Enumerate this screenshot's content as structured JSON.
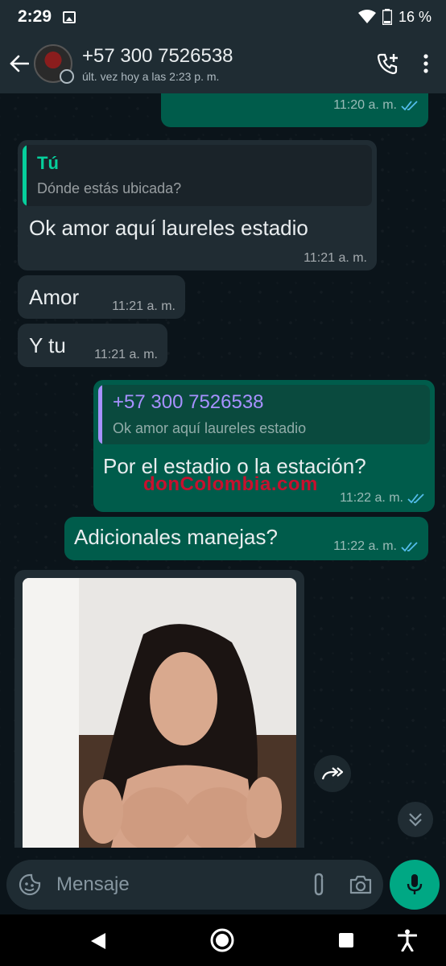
{
  "status": {
    "time": "2:29",
    "battery": "16 %"
  },
  "header": {
    "name": "+57 300 7526538",
    "last_seen": "últ. vez hoy a las 2:23 p. m."
  },
  "messages": [
    {
      "meta": "11:20 a. m."
    },
    {
      "quote_name": "Tú",
      "quote_text": "Dónde estás ubicada?",
      "text": "Ok  amor aquí laureles estadio",
      "meta": "11:21 a. m."
    },
    {
      "text": "Amor",
      "meta": "11:21 a. m."
    },
    {
      "text": "Y tu",
      "meta": "11:21 a. m."
    },
    {
      "quote_name": "+57 300 7526538",
      "quote_text": "Ok  amor aquí laureles estadio",
      "text": "Por el estadio o la estación?",
      "meta": "11:22 a. m."
    },
    {
      "text": "Adicionales manejas?",
      "meta": "11:22 a. m."
    }
  ],
  "watermark": "donColombia.com",
  "composer": {
    "placeholder": "Mensaje"
  },
  "colors": {
    "accent": "#00a884",
    "out_bubble": "#005c4b",
    "in_bubble": "#202c33",
    "tick": "#53bdeb",
    "quote_self": "#06cf9c",
    "quote_other": "#a791ff"
  }
}
